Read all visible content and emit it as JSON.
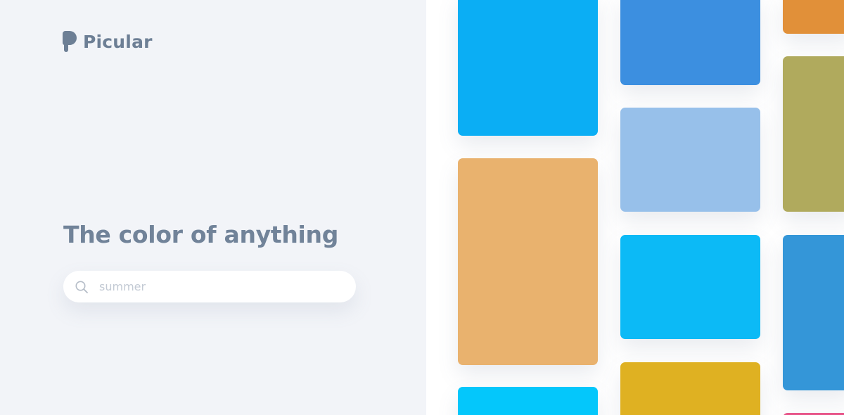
{
  "brand": {
    "name": "Picular",
    "logo_icon": "picular-logo-icon",
    "text_color": "#6d7f95"
  },
  "hero": {
    "title": "The color of anything"
  },
  "search": {
    "icon": "search-icon",
    "placeholder": "summer",
    "value": ""
  },
  "colors": {
    "left_background": "#f2f4f8",
    "right_background": "#ffffff"
  },
  "swatches": [
    {
      "column": 1,
      "row": 1,
      "color": "#0baef4"
    },
    {
      "column": 1,
      "row": 2,
      "color": "#e9b26e"
    },
    {
      "column": 1,
      "row": 3,
      "color": "#04c7fb"
    },
    {
      "column": 2,
      "row": 1,
      "color": "#3c8fe0"
    },
    {
      "column": 2,
      "row": 2,
      "color": "#97c0ea"
    },
    {
      "column": 2,
      "row": 3,
      "color": "#0cbaf6"
    },
    {
      "column": 2,
      "row": 4,
      "color": "#dfb122"
    },
    {
      "column": 3,
      "row": 1,
      "color": "#e19039"
    },
    {
      "column": 3,
      "row": 2,
      "color": "#b0aa5d"
    },
    {
      "column": 3,
      "row": 3,
      "color": "#3496d8"
    },
    {
      "column": 3,
      "row": 4,
      "color": "#e7568a"
    }
  ]
}
